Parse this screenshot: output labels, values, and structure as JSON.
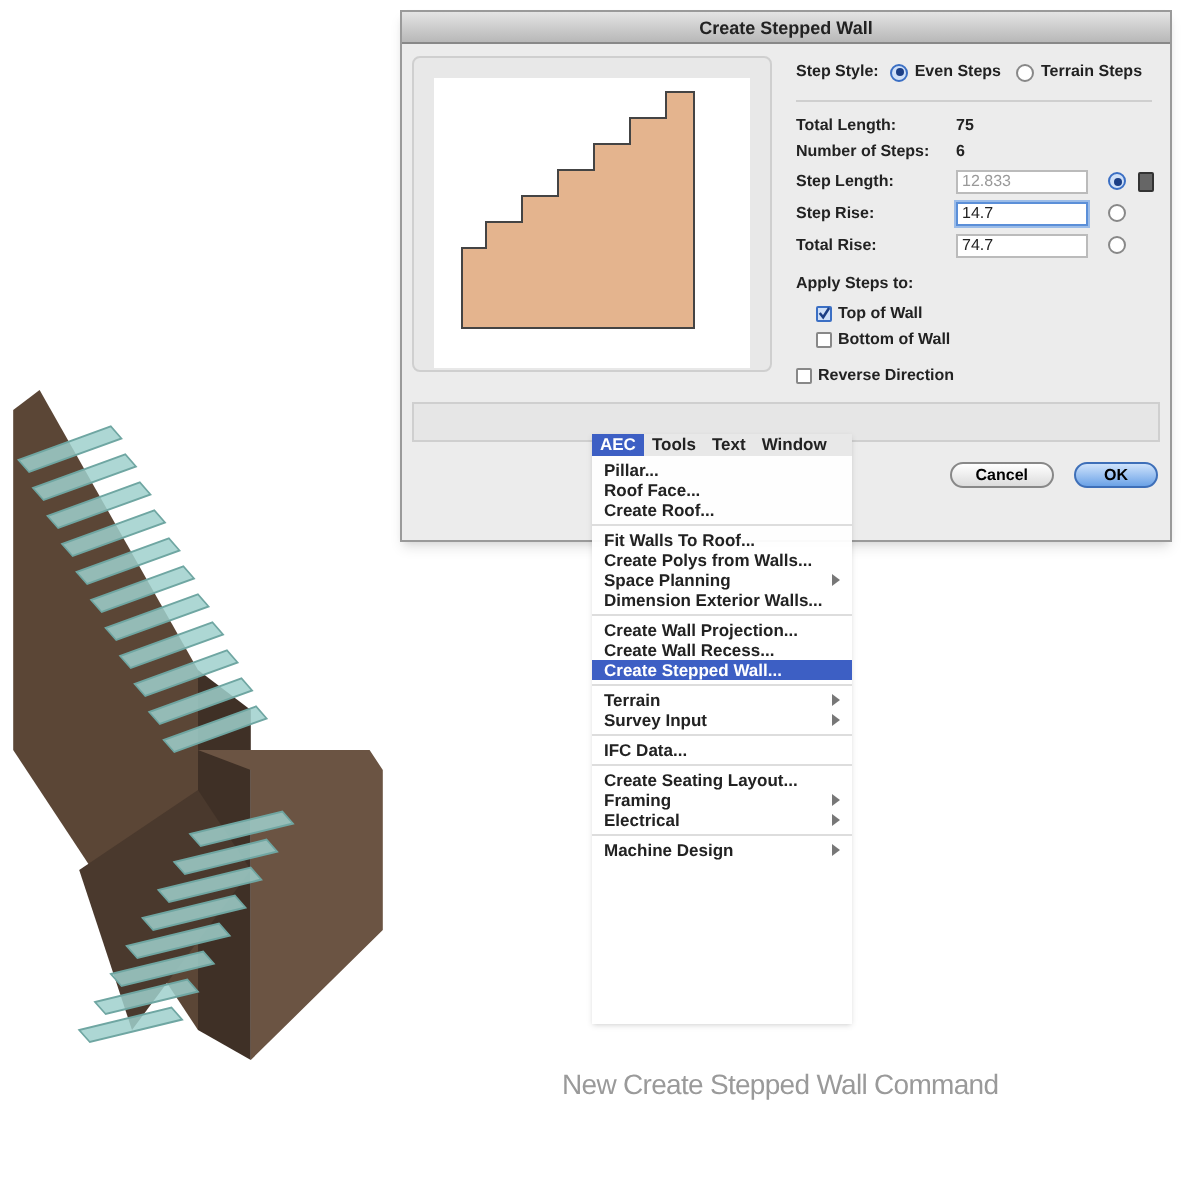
{
  "dialog": {
    "title": "Create Stepped Wall",
    "step_style": {
      "label": "Step Style:",
      "options": [
        {
          "label": "Even Steps",
          "selected": true
        },
        {
          "label": "Terrain Steps",
          "selected": false
        }
      ]
    },
    "info": [
      {
        "label": "Total Length:",
        "value": "75"
      },
      {
        "label": "Number of Steps:",
        "value": "6"
      }
    ],
    "fields": [
      {
        "label": "Step Length:",
        "value": "12.833",
        "disabled": true,
        "focused": false,
        "selected": true,
        "calculator": true
      },
      {
        "label": "Step Rise:",
        "value": "14.7",
        "disabled": false,
        "focused": true,
        "selected": false,
        "calculator": false
      },
      {
        "label": "Total Rise:",
        "value": "74.7",
        "disabled": false,
        "focused": false,
        "selected": false,
        "calculator": false
      }
    ],
    "apply_label": "Apply Steps to:",
    "apply_options": [
      {
        "label": "Top of Wall",
        "checked": true
      },
      {
        "label": "Bottom of Wall",
        "checked": false
      }
    ],
    "reverse": {
      "label": "Reverse Direction",
      "checked": false
    },
    "buttons": [
      {
        "label": "Cancel",
        "default": false
      },
      {
        "label": "OK",
        "default": true
      }
    ]
  },
  "menu": {
    "bar": [
      {
        "label": "AEC",
        "selected": true
      },
      {
        "label": "Tools",
        "selected": false
      },
      {
        "label": "Text",
        "selected": false
      },
      {
        "label": "Window",
        "selected": false
      }
    ],
    "groups": [
      [
        {
          "label": "Pillar...",
          "submenu": false,
          "selected": false
        },
        {
          "label": "Roof Face...",
          "submenu": false,
          "selected": false
        },
        {
          "label": "Create Roof...",
          "submenu": false,
          "selected": false
        }
      ],
      [
        {
          "label": "Fit Walls To Roof...",
          "submenu": false,
          "selected": false
        },
        {
          "label": "Create Polys from Walls...",
          "submenu": false,
          "selected": false
        },
        {
          "label": "Space Planning",
          "submenu": true,
          "selected": false
        },
        {
          "label": "Dimension Exterior Walls...",
          "submenu": false,
          "selected": false
        }
      ],
      [
        {
          "label": "Create Wall Projection...",
          "submenu": false,
          "selected": false
        },
        {
          "label": "Create Wall Recess...",
          "submenu": false,
          "selected": false
        },
        {
          "label": "Create Stepped Wall...",
          "submenu": false,
          "selected": true
        }
      ],
      [
        {
          "label": "Terrain",
          "submenu": true,
          "selected": false
        },
        {
          "label": "Survey Input",
          "submenu": true,
          "selected": false
        }
      ],
      [
        {
          "label": "IFC Data...",
          "submenu": false,
          "selected": false
        }
      ],
      [
        {
          "label": "Create Seating Layout...",
          "submenu": false,
          "selected": false
        },
        {
          "label": "Framing",
          "submenu": true,
          "selected": false
        },
        {
          "label": "Electrical",
          "submenu": true,
          "selected": false
        }
      ],
      [
        {
          "label": "Machine Design",
          "submenu": true,
          "selected": false
        }
      ]
    ]
  },
  "caption": "New Create Stepped Wall Command"
}
